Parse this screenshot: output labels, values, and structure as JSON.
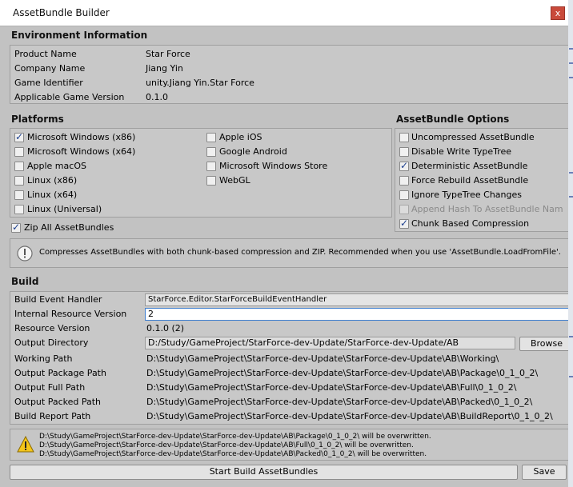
{
  "window": {
    "title": "AssetBundle Builder",
    "close_glyph": "x"
  },
  "environment": {
    "title": "Environment Information",
    "rows": [
      {
        "label": "Product Name",
        "value": "Star Force"
      },
      {
        "label": "Company Name",
        "value": "Jiang Yin"
      },
      {
        "label": "Game Identifier",
        "value": "unity.Jiang Yin.Star Force"
      },
      {
        "label": "Applicable Game Version",
        "value": "0.1.0"
      }
    ]
  },
  "platforms": {
    "title": "Platforms",
    "left": [
      {
        "label": "Microsoft Windows (x86)",
        "checked": true
      },
      {
        "label": "Microsoft Windows (x64)",
        "checked": false
      },
      {
        "label": "Apple macOS",
        "checked": false
      },
      {
        "label": "Linux (x86)",
        "checked": false
      },
      {
        "label": "Linux (x64)",
        "checked": false
      },
      {
        "label": "Linux (Universal)",
        "checked": false
      }
    ],
    "right": [
      {
        "label": "Apple iOS",
        "checked": false
      },
      {
        "label": "Google Android",
        "checked": false
      },
      {
        "label": "Microsoft Windows Store",
        "checked": false
      },
      {
        "label": "WebGL",
        "checked": false
      }
    ],
    "zip_all": {
      "label": "Zip All AssetBundles",
      "checked": true
    }
  },
  "assetbundle_options": {
    "title": "AssetBundle Options",
    "items": [
      {
        "label": "Uncompressed AssetBundle",
        "checked": false,
        "disabled": false
      },
      {
        "label": "Disable Write TypeTree",
        "checked": false,
        "disabled": false
      },
      {
        "label": "Deterministic AssetBundle",
        "checked": true,
        "disabled": false
      },
      {
        "label": "Force Rebuild AssetBundle",
        "checked": false,
        "disabled": false
      },
      {
        "label": "Ignore TypeTree Changes",
        "checked": false,
        "disabled": false
      },
      {
        "label": "Append Hash To AssetBundle Nam",
        "checked": false,
        "disabled": true
      },
      {
        "label": "Chunk Based Compression",
        "checked": true,
        "disabled": false
      }
    ]
  },
  "info": {
    "icon": "info-icon",
    "text": "Compresses AssetBundles with both chunk-based compression and ZIP. Recommended when you use 'AssetBundle.LoadFromFile'."
  },
  "build": {
    "title": "Build",
    "event_handler": {
      "label": "Build Event Handler",
      "value": "StarForce.Editor.StarForceBuildEventHandler"
    },
    "internal_resource_version": {
      "label": "Internal Resource Version",
      "value": "2"
    },
    "resource_version": {
      "label": "Resource Version",
      "value": "0.1.0 (2)"
    },
    "output_directory": {
      "label": "Output Directory",
      "value": "D:/Study/GameProject/StarForce-dev-Update/StarForce-dev-Update/AB",
      "browse_label": "Browse"
    },
    "paths": [
      {
        "label": "Working Path",
        "value": "D:\\Study\\GameProject\\StarForce-dev-Update\\StarForce-dev-Update\\AB\\Working\\"
      },
      {
        "label": "Output Package Path",
        "value": "D:\\Study\\GameProject\\StarForce-dev-Update\\StarForce-dev-Update\\AB\\Package\\0_1_0_2\\"
      },
      {
        "label": "Output Full Path",
        "value": "D:\\Study\\GameProject\\StarForce-dev-Update\\StarForce-dev-Update\\AB\\Full\\0_1_0_2\\"
      },
      {
        "label": "Output Packed Path",
        "value": "D:\\Study\\GameProject\\StarForce-dev-Update\\StarForce-dev-Update\\AB\\Packed\\0_1_0_2\\"
      },
      {
        "label": "Build Report Path",
        "value": "D:\\Study\\GameProject\\StarForce-dev-Update\\StarForce-dev-Update\\AB\\BuildReport\\0_1_0_2\\"
      }
    ]
  },
  "warning": {
    "icon": "warning-icon",
    "lines": [
      "D:\\Study\\GameProject\\StarForce-dev-Update\\StarForce-dev-Update\\AB\\Package\\0_1_0_2\\ will be overwritten.",
      "D:\\Study\\GameProject\\StarForce-dev-Update\\StarForce-dev-Update\\AB\\Full\\0_1_0_2\\ will be overwritten.",
      "D:\\Study\\GameProject\\StarForce-dev-Update\\StarForce-dev-Update\\AB\\Packed\\0_1_0_2\\ will be overwritten."
    ]
  },
  "footer": {
    "start_build_label": "Start Build AssetBundles",
    "save_label": "Save"
  }
}
